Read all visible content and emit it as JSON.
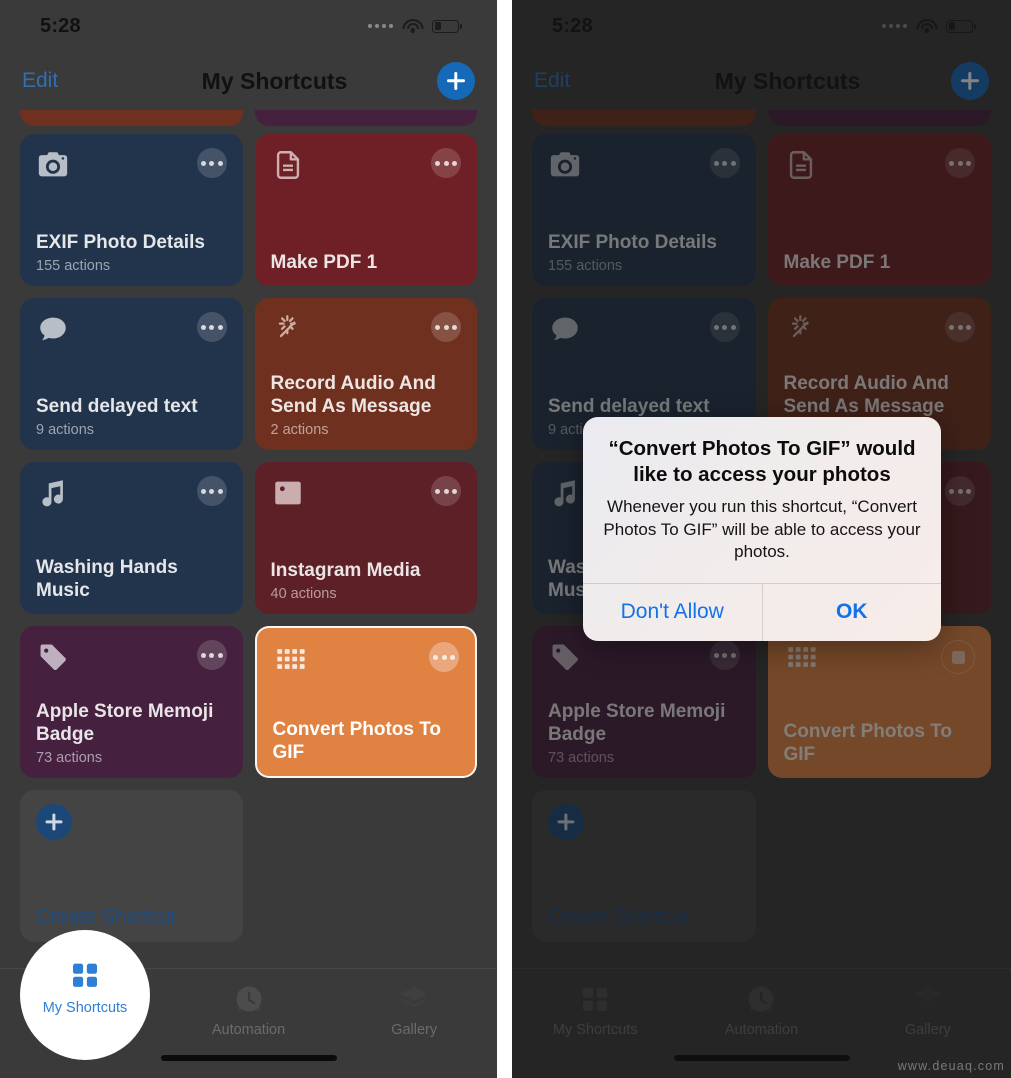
{
  "status_bar": {
    "time": "5:28",
    "wifi_icon": "wifi-icon",
    "battery_icon": "battery-low-icon",
    "cellular_icon": "cellular-dots-icon"
  },
  "nav": {
    "edit_label": "Edit",
    "title": "My Shortcuts",
    "add_icon": "plus-icon"
  },
  "shortcuts": [
    {
      "name": "EXIF Photo Details",
      "subtitle": "155 actions",
      "color": "#22334c",
      "icon": "camera-icon"
    },
    {
      "name": "Make PDF 1",
      "subtitle": "",
      "color": "#6e2026",
      "icon": "document-icon"
    },
    {
      "name": "Send delayed text",
      "subtitle": "9 actions",
      "color": "#22334c",
      "icon": "message-bubble-icon"
    },
    {
      "name": "Record Audio And Send As Message",
      "subtitle": "2 actions",
      "color": "#70301f",
      "icon": "magic-wand-icon"
    },
    {
      "name": "Washing Hands Music",
      "subtitle": "",
      "color": "#22334c",
      "icon": "music-note-icon"
    },
    {
      "name": "Instagram Media",
      "subtitle": "40 actions",
      "color": "#5d2027",
      "icon": "photo-icon"
    },
    {
      "name": "Apple Store Memoji Badge",
      "subtitle": "73 actions",
      "color": "#46213f",
      "icon": "tag-icon"
    },
    {
      "name": "Convert Photos To GIF",
      "subtitle": "",
      "color": "#e08242",
      "icon": "grid-dots-icon"
    }
  ],
  "create_tile": {
    "label": "Create Shortcut",
    "icon": "plus-circle-icon"
  },
  "tabs": [
    {
      "label": "My Shortcuts",
      "icon": "grid-squares-icon",
      "active": true
    },
    {
      "label": "Automation",
      "icon": "clock-icon",
      "active": false
    },
    {
      "label": "Gallery",
      "icon": "layers-icon",
      "active": false
    }
  ],
  "alert": {
    "title": "“Convert Photos To GIF” would like to access your photos",
    "message": "Whenever you run this shortcut, “Convert Photos To GIF” will be able to access your photos.",
    "deny_label": "Don't Allow",
    "allow_label": "OK"
  },
  "running_tile_icon": "stop-icon",
  "watermark": "www.deuaq.com",
  "colors": {
    "accent_blue": "#1668b8",
    "link_blue": "#1272ec",
    "tab_active": "#2f7fd6",
    "selected_tile": "#e08242"
  }
}
